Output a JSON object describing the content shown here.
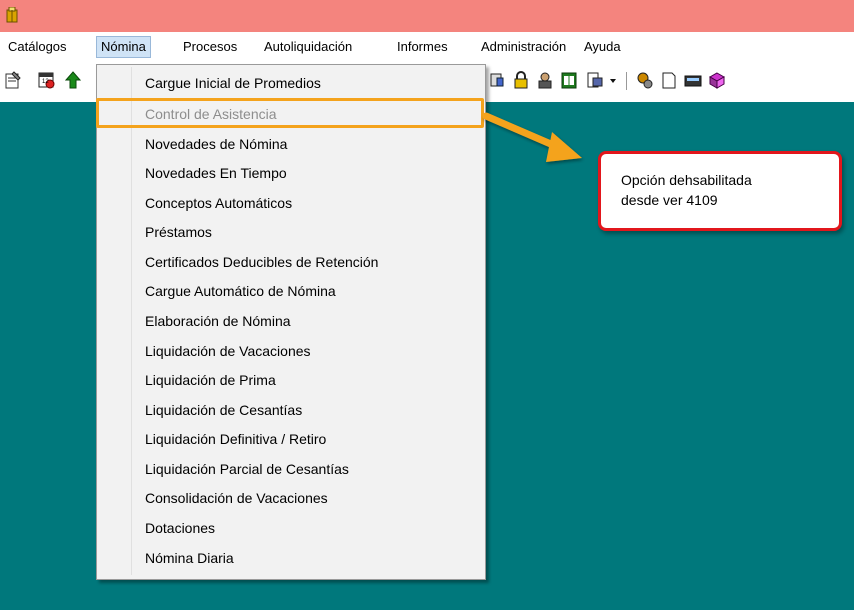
{
  "menubar": {
    "items": [
      {
        "label": "Catálogos"
      },
      {
        "label": "Nómina"
      },
      {
        "label": "Procesos"
      },
      {
        "label": "Autoliquidación"
      },
      {
        "label": "Informes"
      },
      {
        "label": "Administración"
      },
      {
        "label": "Ayuda"
      }
    ]
  },
  "dropdown": {
    "items": [
      {
        "label": "Cargue Inicial de Promedios"
      },
      {
        "label": "Control de Asistencia"
      },
      {
        "label": "Novedades de Nómina"
      },
      {
        "label": "Novedades En Tiempo"
      },
      {
        "label": "Conceptos Automáticos"
      },
      {
        "label": "Préstamos"
      },
      {
        "label": "Certificados Deducibles de Retención"
      },
      {
        "label": "Cargue Automático de Nómina"
      },
      {
        "label": "Elaboración de Nómina"
      },
      {
        "label": "Liquidación de Vacaciones"
      },
      {
        "label": "Liquidación de Prima"
      },
      {
        "label": "Liquidación de Cesantías"
      },
      {
        "label": "Liquidación Definitiva / Retiro"
      },
      {
        "label": "Liquidación Parcial de Cesantías"
      },
      {
        "label": "Consolidación de Vacaciones"
      },
      {
        "label": "Dotaciones"
      },
      {
        "label": "Nómina Diaria"
      }
    ]
  },
  "callout": {
    "line1": "Opción dehsabilitada",
    "line2": "desde ver 4109"
  },
  "colors": {
    "titlebar": "#f4847e",
    "workarea": "#00787c",
    "highlight": "#f4a31d",
    "callout_border": "#e2161c"
  }
}
